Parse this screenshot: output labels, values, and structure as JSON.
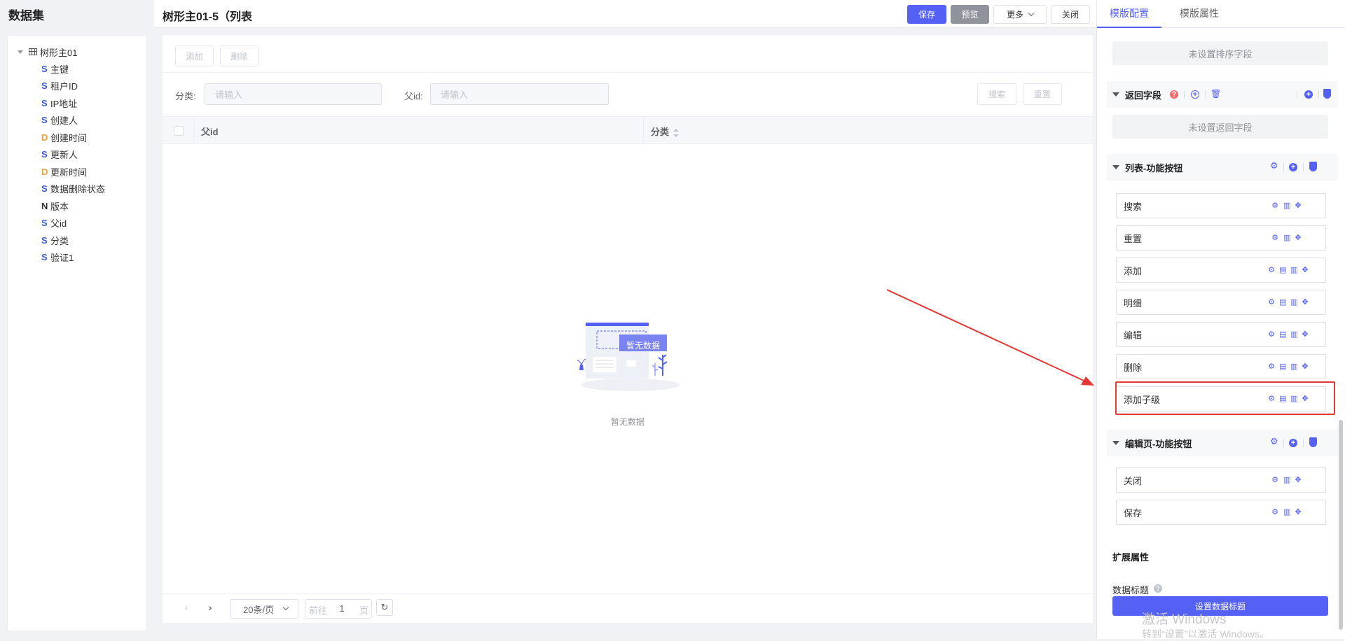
{
  "left": {
    "title": "数据集",
    "root": "树形主01",
    "fields": [
      {
        "type": "S",
        "name": "主键"
      },
      {
        "type": "S",
        "name": "租户ID"
      },
      {
        "type": "S",
        "name": "IP地址"
      },
      {
        "type": "S",
        "name": "创建人"
      },
      {
        "type": "D",
        "name": "创建时间"
      },
      {
        "type": "S",
        "name": "更新人"
      },
      {
        "type": "D",
        "name": "更新时间"
      },
      {
        "type": "S",
        "name": "数据删除状态"
      },
      {
        "type": "N",
        "name": "版本"
      },
      {
        "type": "S",
        "name": "父id"
      },
      {
        "type": "S",
        "name": "分类"
      },
      {
        "type": "S",
        "name": "验证1"
      }
    ]
  },
  "header": {
    "title": "树形主01-5（列表",
    "save": "保存",
    "preview": "预览",
    "more": "更多",
    "close": "关闭"
  },
  "main": {
    "add": "添加",
    "delete": "删除",
    "filters": [
      {
        "label": "分类:",
        "placeholder": "请输入"
      },
      {
        "label": "父id:",
        "placeholder": "请输入"
      }
    ],
    "search": "搜索",
    "reset": "重置",
    "columns": [
      "父id",
      "分类"
    ],
    "empty_badge": "暂无数据",
    "empty_text": "暂无数据",
    "pager": {
      "page_size": "20条/页",
      "goto": "前往",
      "page": "1",
      "page_unit": "页"
    }
  },
  "right": {
    "tabs": [
      "模版配置",
      "模版属性"
    ],
    "sort_placeholder": "未设置排序字段",
    "return_fields": {
      "title": "返回字段",
      "placeholder": "未设置返回字段"
    },
    "list_buttons": {
      "title": "列表-功能按钮",
      "items": [
        "搜索",
        "重置",
        "添加",
        "明细",
        "编辑",
        "删除",
        "添加子级"
      ]
    },
    "edit_buttons": {
      "title": "编辑页-功能按钮",
      "items": [
        "关闭",
        "保存"
      ]
    },
    "ext": {
      "title": "扩展属性",
      "data_title_label": "数据标题",
      "set_title_button": "设置数据标题"
    }
  },
  "watermark": {
    "line1": "激活 Windows",
    "line2": "转到“设置”以激活 Windows。"
  },
  "colors": {
    "accent": "#5561f5",
    "highlight": "#e53935"
  }
}
